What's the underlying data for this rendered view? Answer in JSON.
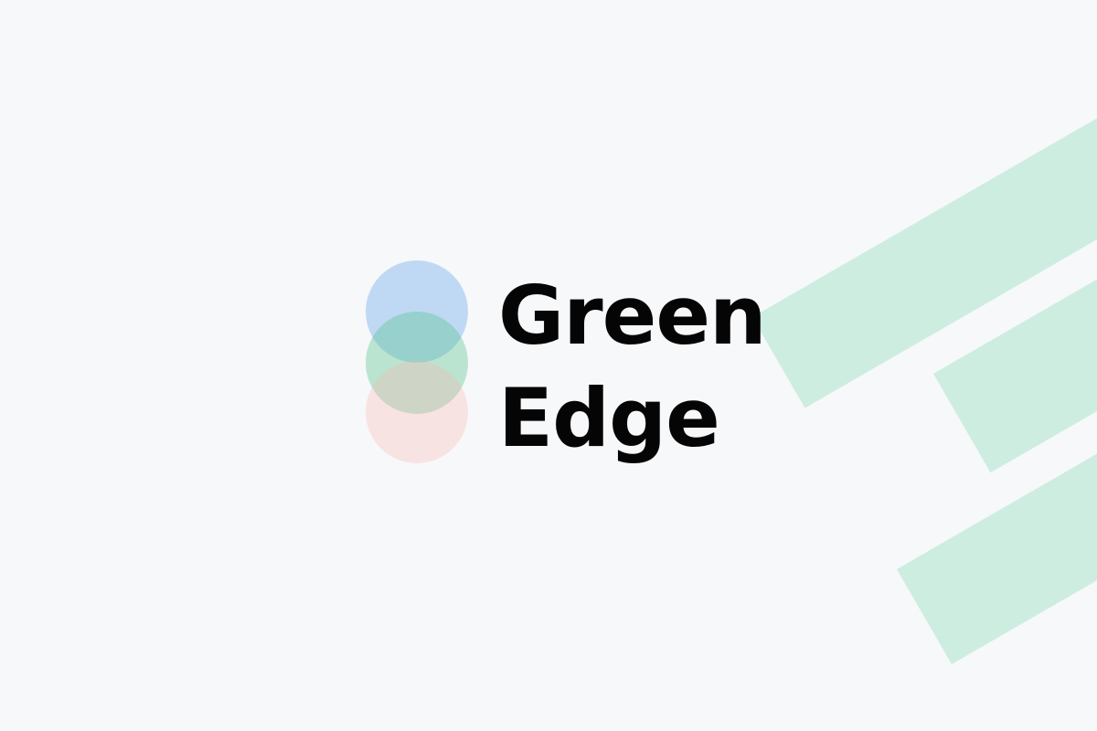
{
  "brand": {
    "line1": "Green",
    "line2": "Edge"
  },
  "colors": {
    "background": "#f7f8fa",
    "stripe": "#cdede0",
    "circle_blue": "rgba(135, 185, 240, 0.5)",
    "circle_green": "rgba(90, 195, 140, 0.38)",
    "circle_red": "rgba(252, 180, 175, 0.3)",
    "text": "#050505"
  }
}
